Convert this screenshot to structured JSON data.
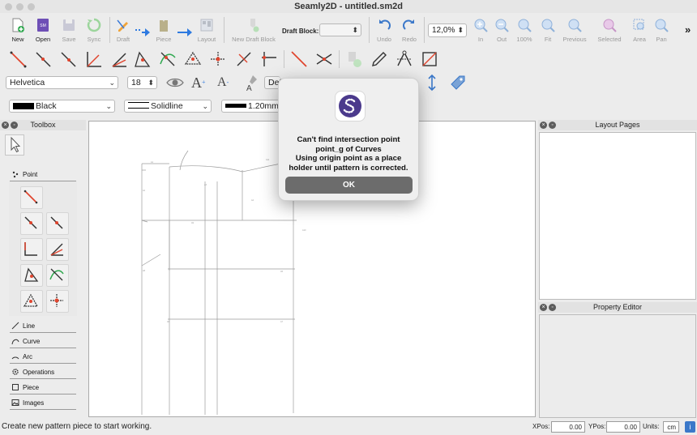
{
  "window": {
    "title": "Seamly2D - untitled.sm2d"
  },
  "toolbar": {
    "new": "New",
    "open": "Open",
    "save": "Save",
    "sync": "Sync",
    "draft": "Draft",
    "piece": "Piece",
    "layout": "Layout",
    "new_draft_block": "New Draft Block",
    "draft_block_label": "Draft Block:",
    "undo": "Undo",
    "redo": "Redo",
    "zoom_value": "12,0%",
    "zoom_in": "In",
    "zoom_out": "Out",
    "zoom_100": "100%",
    "zoom_fit": "Fit",
    "previous": "Previous",
    "selected": "Selected",
    "area": "Area",
    "pan": "Pan",
    "more": "»"
  },
  "textbar": {
    "font": "Helvetica",
    "size": "18",
    "default_combo": "Def"
  },
  "linebar": {
    "color": "Black",
    "color_hex": "#000000",
    "line_type": "Solidline",
    "line_width": "1.20mm"
  },
  "toolbox": {
    "title": "Toolbox",
    "sections": [
      "Point",
      "Line",
      "Curve",
      "Arc",
      "Operations",
      "Piece",
      "Images"
    ]
  },
  "layout_pages": {
    "title": "Layout Pages"
  },
  "property_editor": {
    "title": "Property Editor"
  },
  "dialog": {
    "line1": "Can't find intersection point",
    "line2": "point_g of Curves",
    "line3": "Using origin point as a place",
    "line4": "holder until pattern is corrected.",
    "ok": "OK"
  },
  "status": {
    "message": "Create new pattern piece to start working.",
    "xpos_label": "XPos:",
    "xpos": "0.00",
    "ypos_label": "YPos:",
    "ypos": "0.00",
    "units_label": "Units:",
    "units": "cm"
  },
  "colors": {
    "accent_red": "#e0452e",
    "accent_blue": "#2e7ae0",
    "logo_purple": "#4b3a8c"
  }
}
